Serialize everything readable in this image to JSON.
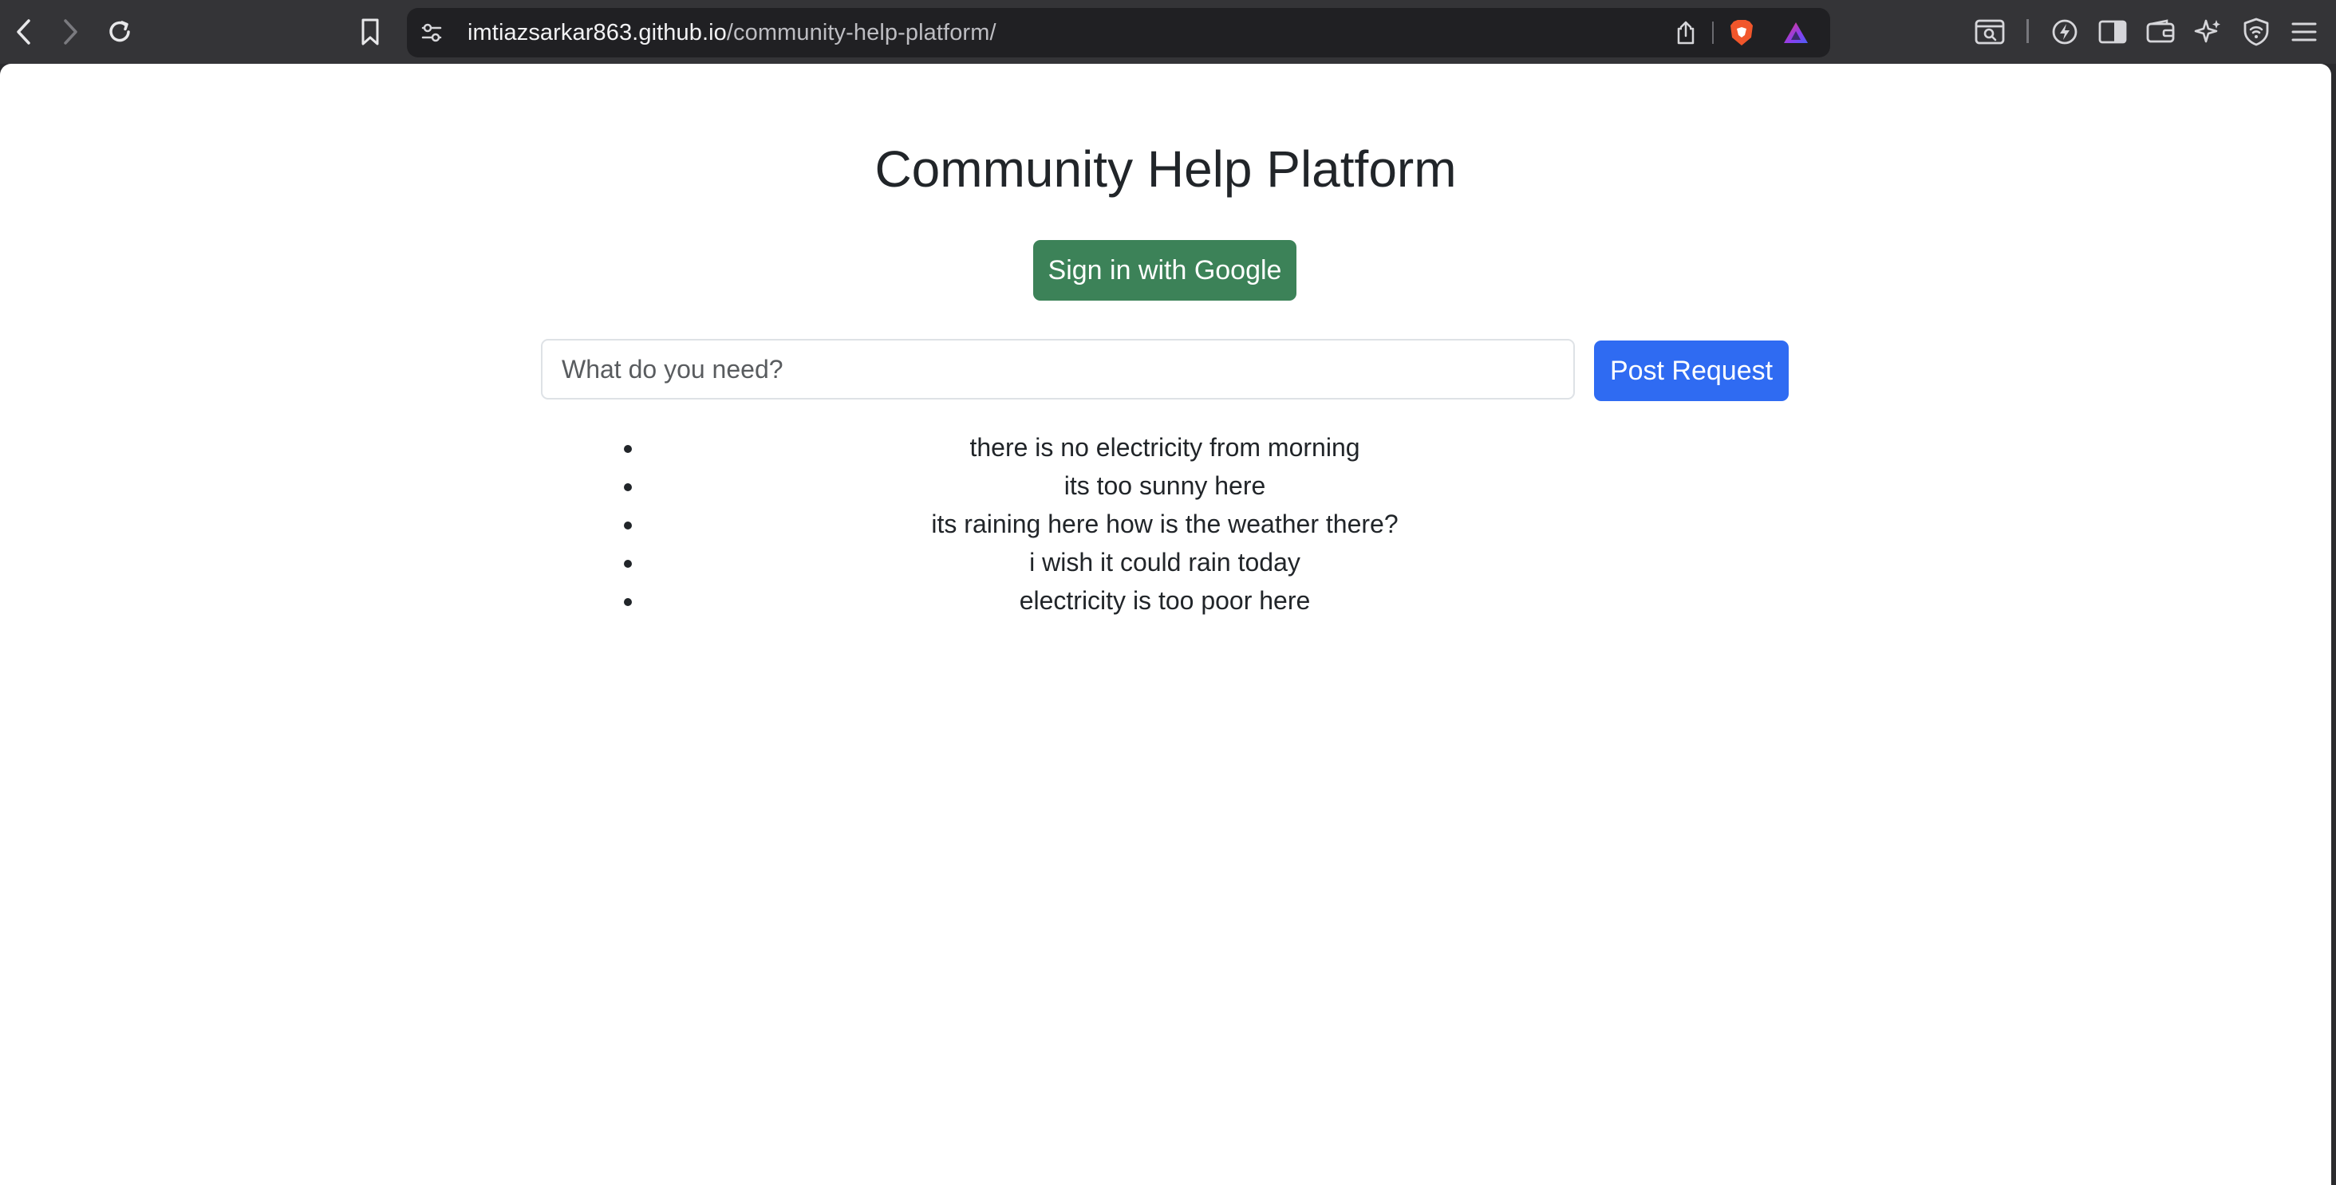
{
  "browser": {
    "url_host": "imtiazsarkar863.github.io",
    "url_path": "/community-help-platform/"
  },
  "page": {
    "title": "Community Help Platform",
    "signin_label": "Sign in with Google",
    "request_placeholder": "What do you need?",
    "post_label": "Post Request",
    "requests": [
      "there is no electricity from morning",
      "its too sunny here",
      "its raining here how is the weather there?",
      "i wish it could rain today",
      "electricity is too poor here"
    ]
  },
  "colors": {
    "signin_button": "#3c8258",
    "post_button": "#2f6bf2",
    "browser_chrome": "#343437"
  }
}
